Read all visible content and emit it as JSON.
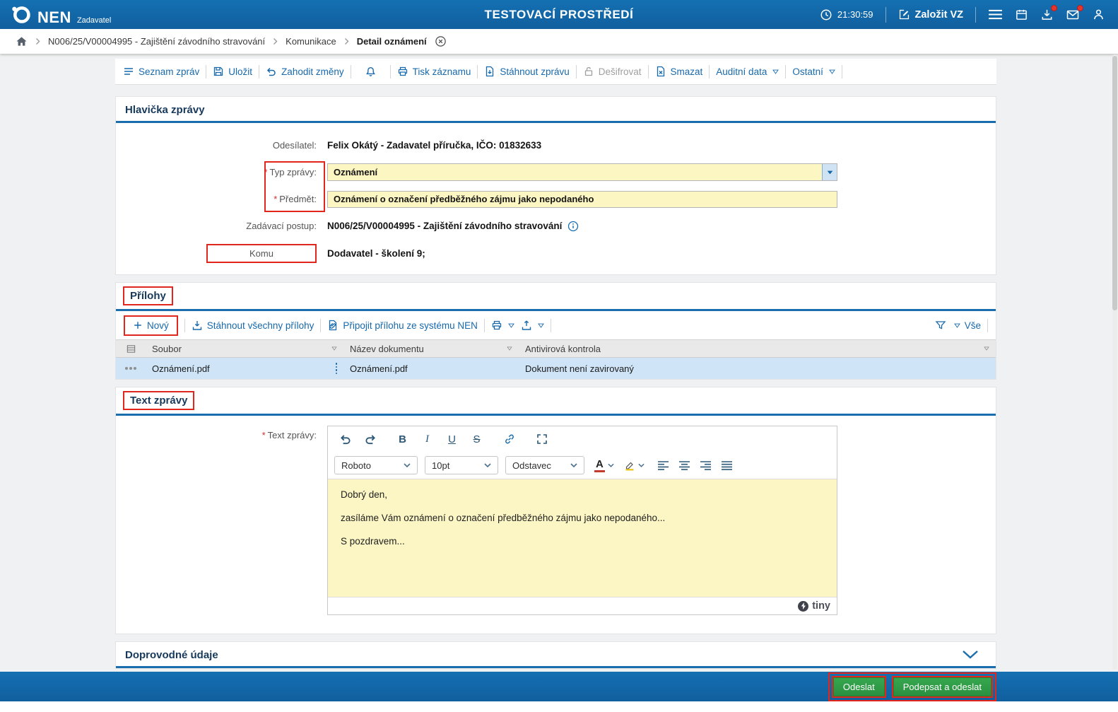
{
  "topbar": {
    "brand": "NEN",
    "brand_sub": "Zadavatel",
    "env_title": "TESTOVACÍ PROSTŘEDÍ",
    "time": "21:30:59",
    "create_vz": "Založit VZ"
  },
  "breadcrumb": {
    "crumb1": "N006/25/V00004995 - Zajištění závodního stravování",
    "crumb2": "Komunikace",
    "crumb3": "Detail oznámení"
  },
  "commands": {
    "seznam": "Seznam zpráv",
    "ulozit": "Uložit",
    "zahodit": "Zahodit změny",
    "tisk": "Tisk záznamu",
    "stahnout": "Stáhnout zprávu",
    "desifrovat": "Dešifrovat",
    "smazat": "Smazat",
    "auditni": "Auditní data",
    "ostatni": "Ostatní"
  },
  "required_marker": "*",
  "header_section": {
    "title": "Hlavička zprávy",
    "odesilatel_label": "Odesílatel:",
    "odesilatel_value": "Felix Okátý - Zadavatel příručka, IČO: 01832633",
    "typ_label": "Typ zprávy:",
    "typ_value": "Oznámení",
    "predmet_label": "Předmět:",
    "predmet_value": "Oznámení o označení předběžného zájmu jako nepodaného",
    "postup_label": "Zadávací postup:",
    "postup_value": "N006/25/V00004995 - Zajištění závodního stravování",
    "komu_label": "Komu",
    "komu_value": "Dodavatel - školení 9;"
  },
  "attachments": {
    "title": "Přílohy",
    "novy": "Nový",
    "stahnout_vse": "Stáhnout všechny přílohy",
    "pripojit": "Připojit přílohu ze systému NEN",
    "vse": "Vše",
    "col_soubor": "Soubor",
    "col_nazev": "Název dokumentu",
    "col_antivir": "Antivirová kontrola",
    "row": {
      "soubor": "Oznámení.pdf",
      "nazev": "Oznámení.pdf",
      "antivir": "Dokument není zavirovaný"
    }
  },
  "message": {
    "title": "Text zprávy",
    "label": "Text zprávy:",
    "font": "Roboto",
    "size": "10pt",
    "block": "Odstavec",
    "icons": {
      "bold": "B",
      "italic": "I",
      "underline": "U",
      "strike": "S",
      "color": "A"
    },
    "line1": "Dobrý den,",
    "line2": "zasíláme Vám oznámení o označení předběžného zájmu jako nepodaného...",
    "line3": "S pozdravem...",
    "brand": "tiny"
  },
  "extra_section": {
    "title": "Doprovodné údaje"
  },
  "footer": {
    "odeslat": "Odeslat",
    "podepsat": "Podepsat a odeslat"
  },
  "colors": {
    "accent_blue": "#1367a8",
    "annotation_red": "#e1261d",
    "action_green": "#2f9e44",
    "highlight_yellow": "#fcf6c3"
  }
}
